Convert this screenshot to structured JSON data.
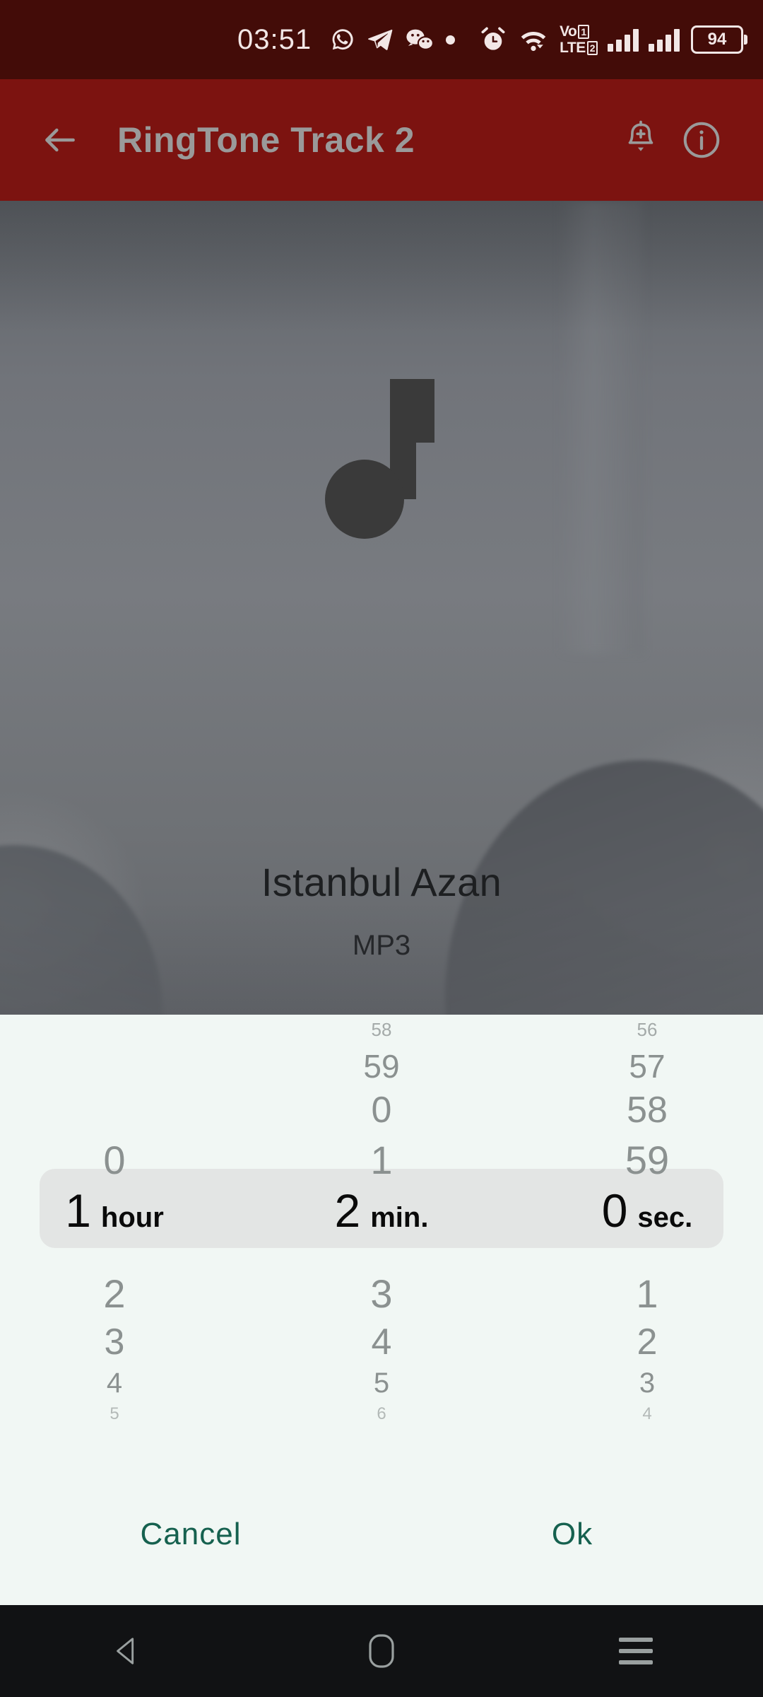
{
  "status_bar": {
    "time": "03:51",
    "left_icons": [
      "whatsapp-icon",
      "telegram-icon",
      "wechat-icon",
      "dot-indicator"
    ],
    "right_icons": [
      "alarm-icon",
      "wifi-icon",
      "volte-icon",
      "signal-sim1-icon",
      "signal-sim2-icon"
    ],
    "volte_label": "VoLTE",
    "volte_badge_1": "1",
    "volte_badge_2": "2",
    "battery_percent": "94",
    "background_color": "#430c08"
  },
  "app_bar": {
    "back_icon": "arrow-left-icon",
    "title": "RingTone Track 2",
    "alarm_add_icon": "bell-add-icon",
    "info_icon": "info-circle-icon",
    "background_color": "#7c1310",
    "title_color": "#9a9a9a"
  },
  "content": {
    "artwork_icon": "music-note-icon",
    "track_title": "Istanbul Azan",
    "track_format": "MP3"
  },
  "picker": {
    "panel_color": "#f1f7f4",
    "selection_band_color": "#e3e5e4",
    "action_color": "#16614f",
    "columns": [
      {
        "name": "hour",
        "unit_label": "hour",
        "selected_value": "1",
        "above": [
          "",
          "",
          "",
          "0"
        ],
        "below": [
          "2",
          "3",
          "4",
          "5"
        ]
      },
      {
        "name": "minute",
        "unit_label": "min.",
        "selected_value": "2",
        "above": [
          "58",
          "59",
          "0",
          "1"
        ],
        "below": [
          "3",
          "4",
          "5",
          "6"
        ]
      },
      {
        "name": "second",
        "unit_label": "sec.",
        "selected_value": "0",
        "above": [
          "56",
          "57",
          "58",
          "59"
        ],
        "below": [
          "1",
          "2",
          "3",
          "4"
        ]
      }
    ],
    "cancel_label": "Cancel",
    "ok_label": "Ok"
  },
  "nav_bar": {
    "back_icon": "triangle-back-icon",
    "home_icon": "home-rect-icon",
    "recents_icon": "hamburger-recents-icon",
    "background_color": "#111214"
  }
}
